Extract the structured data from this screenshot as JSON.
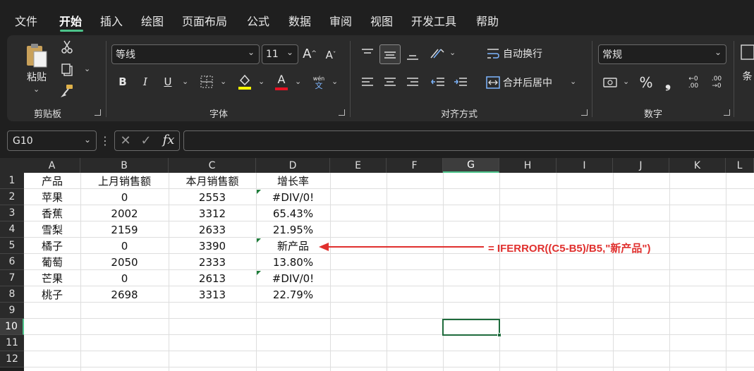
{
  "menu": {
    "tabs": [
      "文件",
      "开始",
      "插入",
      "绘图",
      "页面布局",
      "公式",
      "数据",
      "审阅",
      "视图",
      "开发工具",
      "帮助"
    ],
    "active_tab": "开始"
  },
  "ribbon": {
    "clipboard": {
      "paste_label": "粘贴",
      "group_label": "剪贴板"
    },
    "font": {
      "font_name": "等线",
      "font_size": "11",
      "bold": "B",
      "italic": "I",
      "underline": "U",
      "grow": "A",
      "shrink": "A",
      "font_color_glyph": "A",
      "wen_top": "wén",
      "wen_bottom": "文",
      "group_label": "字体"
    },
    "alignment": {
      "wrap_text": "自动换行",
      "merge_center": "合并后居中",
      "group_label": "对齐方式"
    },
    "number": {
      "format": "常规",
      "percent": "%",
      "comma": "❟",
      "inc_decimal_top": "←0",
      "inc_decimal_bottom": ".00",
      "dec_decimal_top": ".00",
      "dec_decimal_bottom": "→0",
      "group_label": "数字"
    },
    "styles_partial": "条"
  },
  "formula_bar": {
    "name_box": "G10",
    "fx_label": "fx",
    "formula": ""
  },
  "sheet": {
    "columns": [
      "A",
      "B",
      "C",
      "D",
      "E",
      "F",
      "G",
      "H",
      "I",
      "J",
      "K",
      "L"
    ],
    "selected_column": "G",
    "rows": [
      "1",
      "2",
      "3",
      "4",
      "5",
      "6",
      "7",
      "8",
      "9",
      "10",
      "11",
      "12"
    ],
    "selected_row": "10",
    "header": [
      "产品",
      "上月销售额",
      "本月销售额",
      "增长率"
    ],
    "data": [
      [
        "苹果",
        "0",
        "2553",
        "#DIV/0!"
      ],
      [
        "香蕉",
        "2002",
        "3312",
        "65.43%"
      ],
      [
        "雪梨",
        "2159",
        "2633",
        "21.95%"
      ],
      [
        "橘子",
        "0",
        "3390",
        "新产品"
      ],
      [
        "葡萄",
        "2050",
        "2333",
        "13.80%"
      ],
      [
        "芒果",
        "0",
        "2613",
        "#DIV/0!"
      ],
      [
        "桃子",
        "2698",
        "3313",
        "22.79%"
      ]
    ]
  },
  "annotation": {
    "text": "= IFERROR((C5-B5)/B5,\"新产品\")",
    "color": "#e0302e"
  },
  "colors": {
    "accent": "#4cc38a",
    "selection": "#1e6b3c",
    "indicator": "#1e7d3a"
  }
}
